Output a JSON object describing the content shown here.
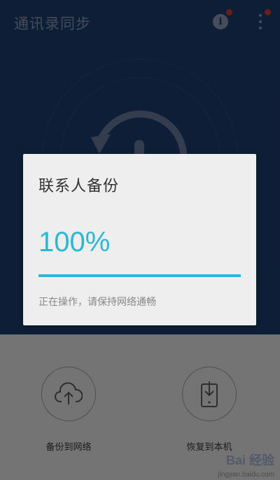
{
  "app": {
    "title": "通讯录同步"
  },
  "header": {
    "info_label": "i"
  },
  "actions": [
    {
      "label": "备份到网络",
      "icon": "cloud-upload-icon"
    },
    {
      "label": "恢复到本机",
      "icon": "phone-download-icon"
    }
  ],
  "dialog": {
    "title": "联系人备份",
    "percent_text": "100%",
    "progress": 1.0,
    "message": "正在操作，请保持网络通畅"
  },
  "watermark": {
    "brand": "Bai 经验",
    "url": "jingyan.baidu.com"
  },
  "colors": {
    "header_bg": "#1b3763",
    "accent": "#2ab8d6",
    "badge": "#c0392b"
  }
}
